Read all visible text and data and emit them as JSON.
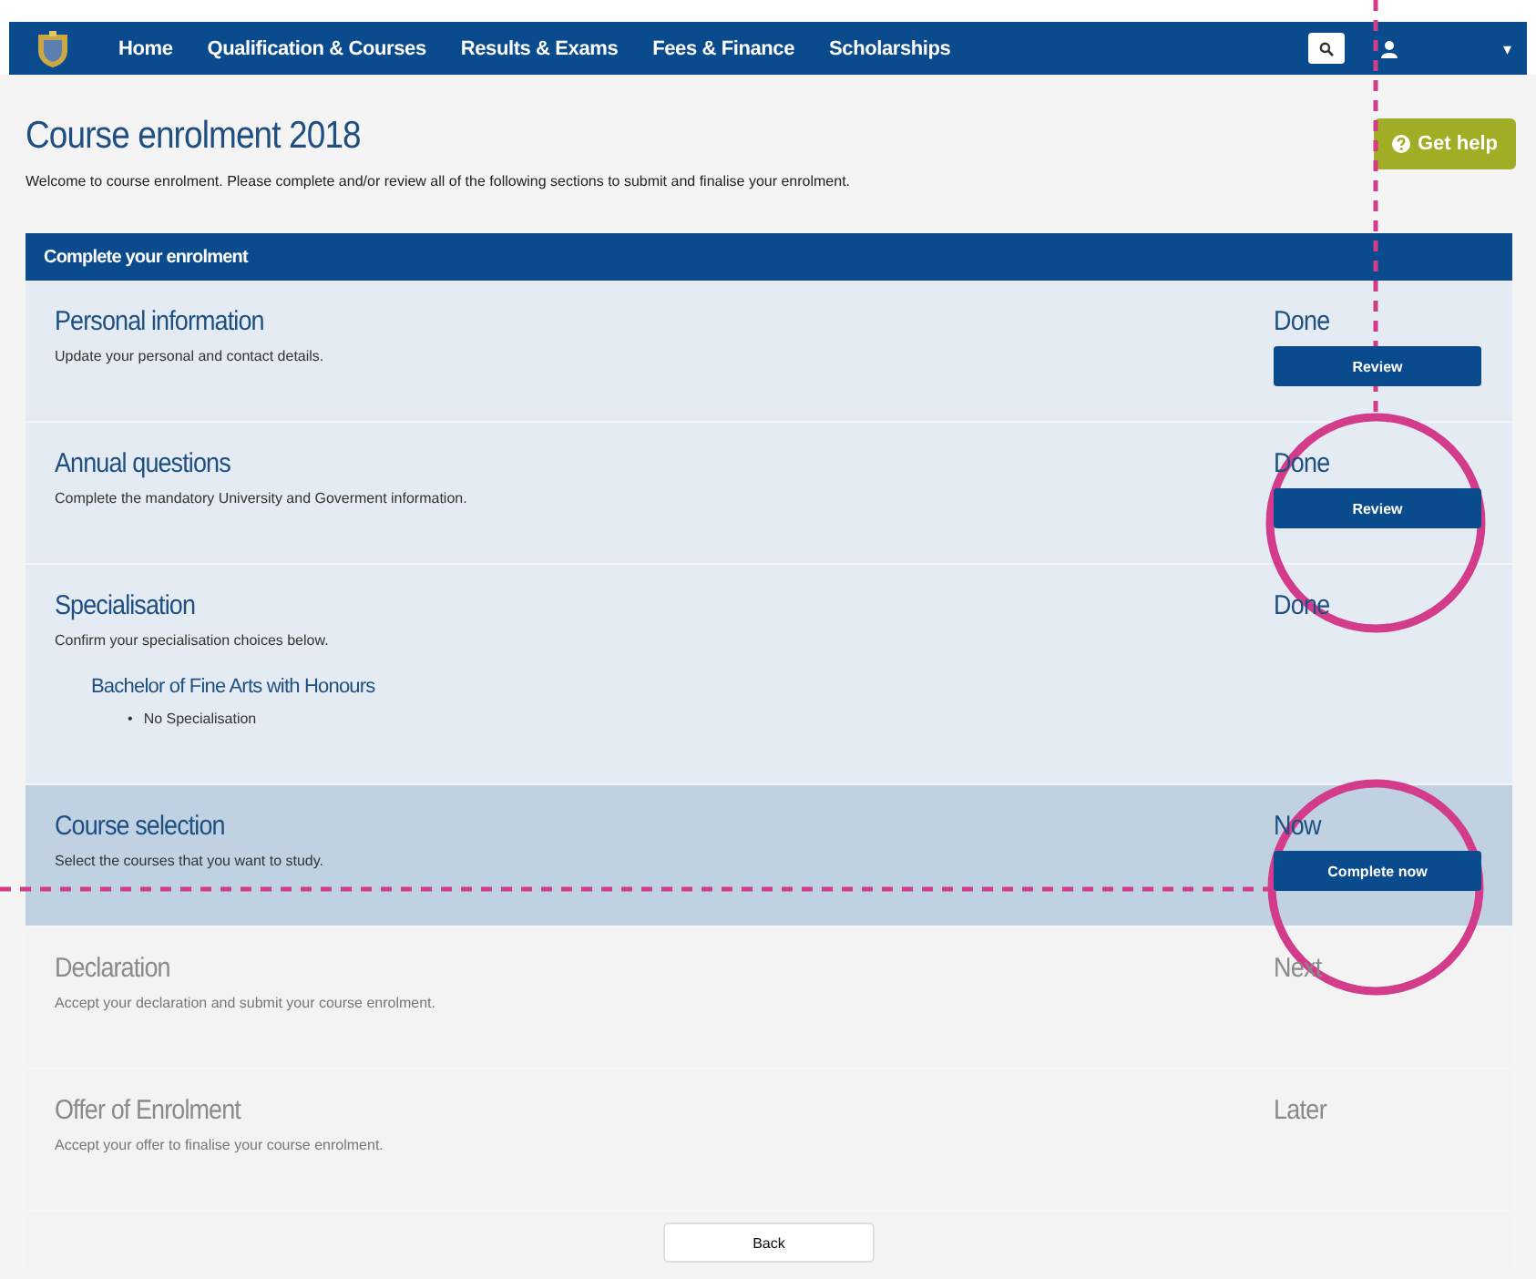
{
  "nav": {
    "items": [
      {
        "label": "Home"
      },
      {
        "label": "Qualification & Courses"
      },
      {
        "label": "Results & Exams"
      },
      {
        "label": "Fees & Finance"
      },
      {
        "label": "Scholarships"
      }
    ],
    "menu_caret": "▾"
  },
  "page": {
    "title": "Course enrolment 2018",
    "intro": "Welcome to course enrolment. Please complete and/or review all of the following sections to submit and finalise your enrolment.",
    "help_button": "Get help"
  },
  "panel": {
    "title": "Complete your enrolment",
    "steps": [
      {
        "kind": "done",
        "title": "Personal information",
        "description": "Update your personal and contact details.",
        "status": "Done",
        "button": "Review"
      },
      {
        "kind": "done",
        "title": "Annual questions",
        "description": "Complete the mandatory University and Goverment information.",
        "status": "Done",
        "button": "Review"
      },
      {
        "kind": "done",
        "title": "Specialisation",
        "description": "Confirm your specialisation choices below.",
        "status": "Done",
        "degree": "Bachelor of Fine Arts with Honours",
        "specialisations": [
          {
            "bullet": "•",
            "text": "No Specialisation"
          }
        ]
      },
      {
        "kind": "current",
        "title": "Course selection",
        "description": "Select the courses that you want to study.",
        "status": "Now",
        "button": "Complete now"
      },
      {
        "kind": "upcoming",
        "title": "Declaration",
        "description": "Accept your declaration and submit your course enrolment.",
        "status": "Next"
      },
      {
        "kind": "upcoming",
        "title": "Offer of Enrolment",
        "description": "Accept your offer to finalise your course enrolment.",
        "status": "Later"
      }
    ],
    "back_button": "Back"
  }
}
